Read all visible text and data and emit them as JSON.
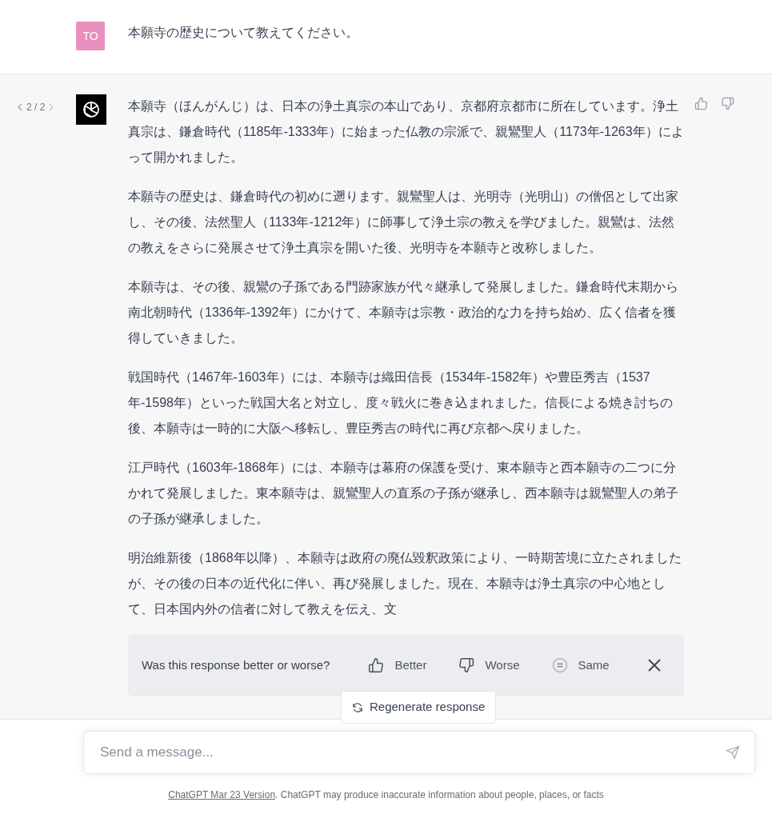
{
  "user_message": {
    "avatar": "TO",
    "text": "本願寺の歴史について教えてください。"
  },
  "assistant_message": {
    "pager": "2 / 2",
    "paragraphs": [
      "本願寺（ほんがんじ）は、日本の浄土真宗の本山であり、京都府京都市に所在しています。浄土真宗は、鎌倉時代（1185年-1333年）に始まった仏教の宗派で、親鸞聖人（1173年-1263年）によって開かれました。",
      "本願寺の歴史は、鎌倉時代の初めに遡ります。親鸞聖人は、光明寺（光明山）の僧侶として出家し、その後、法然聖人（1133年-1212年）に師事して浄土宗の教えを学びました。親鸞は、法然の教えをさらに発展させて浄土真宗を開いた後、光明寺を本願寺と改称しました。",
      "本願寺は、その後、親鸞の子孫である門跡家族が代々継承して発展しました。鎌倉時代末期から南北朝時代（1336年-1392年）にかけて、本願寺は宗教・政治的な力を持ち始め、広く信者を獲得していきました。",
      "戦国時代（1467年-1603年）には、本願寺は織田信長（1534年-1582年）や豊臣秀吉（1537年-1598年）といった戦国大名と対立し、度々戦火に巻き込まれました。信長による焼き討ちの後、本願寺は一時的に大阪へ移転し、豊臣秀吉の時代に再び京都へ戻りました。",
      "江戸時代（1603年-1868年）には、本願寺は幕府の保護を受け、東本願寺と西本願寺の二つに分かれて発展しました。東本願寺は、親鸞聖人の直系の子孫が継承し、西本願寺は親鸞聖人の弟子の子孫が継承しました。",
      "明治維新後（1868年以降）、本願寺は政府の廃仏毀釈政策により、一時期苦境に立たされましたが、その後の日本の近代化に伴い、再び発展しました。現在、本願寺は浄土真宗の中心地として、日本国内外の信者に対して教えを伝え、文"
    ]
  },
  "feedback": {
    "question": "Was this response better or worse?",
    "options": [
      {
        "label": "Better",
        "kind": "better"
      },
      {
        "label": "Worse",
        "kind": "worse"
      },
      {
        "label": "Same",
        "kind": "same"
      }
    ]
  },
  "regenerate_button": "Regenerate response",
  "composer": {
    "placeholder": "Send a message..."
  },
  "footer": {
    "link": "ChatGPT Mar 23 Version",
    "text": ". ChatGPT may produce inaccurate information about people, places, or facts"
  }
}
